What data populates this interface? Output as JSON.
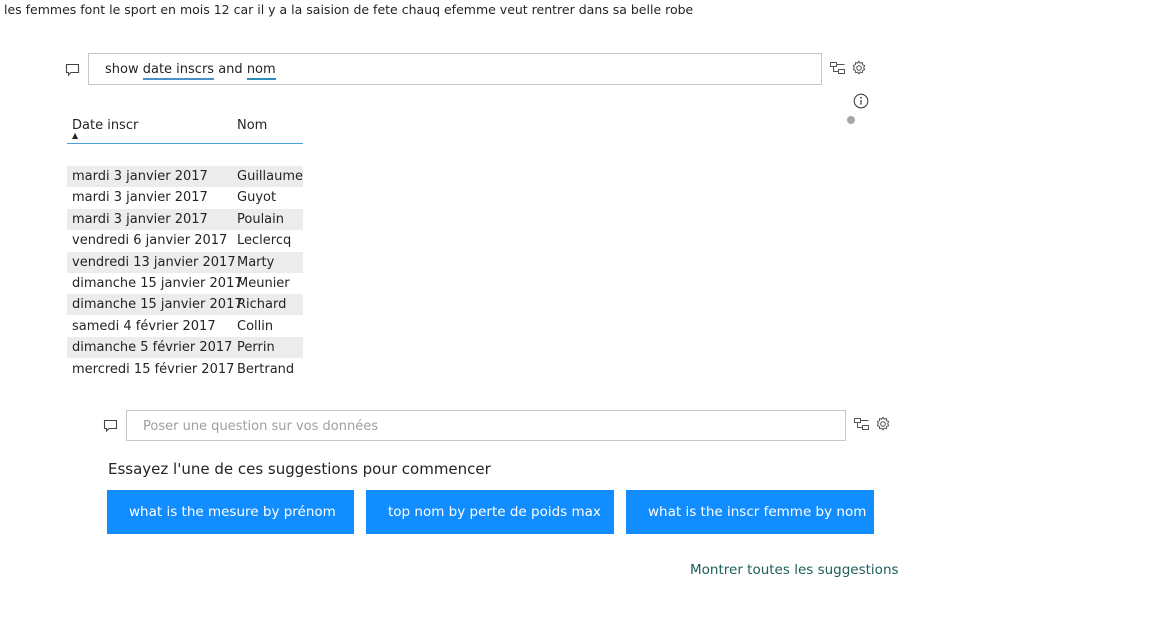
{
  "top_text": "les femmes font le sport en mois 12 car il y a la saision de fete chauq efemme veut rentrer dans sa belle robe",
  "qa_visual": {
    "query": {
      "prefix": "show ",
      "term1": "date inscrs",
      "mid": " and ",
      "term2": "nom"
    },
    "icons": [
      "comment-icon",
      "hierarchy-icon",
      "gear-icon",
      "info-icon"
    ]
  },
  "table": {
    "headers": [
      "Date inscr",
      "Nom"
    ],
    "sort_indicator": "▲",
    "rows": [
      [
        "mardi 3 janvier 2017",
        "Guillaume"
      ],
      [
        "mardi 3 janvier 2017",
        "Guyot"
      ],
      [
        "mardi 3 janvier 2017",
        "Poulain"
      ],
      [
        "vendredi 6 janvier 2017",
        "Leclercq"
      ],
      [
        "vendredi 13 janvier 2017",
        "Marty"
      ],
      [
        "dimanche 15 janvier 2017",
        "Meunier"
      ],
      [
        "dimanche 15 janvier 2017",
        "Richard"
      ],
      [
        "samedi 4 février 2017",
        "Collin"
      ],
      [
        "dimanche 5 février 2017",
        "Perrin"
      ],
      [
        "mercredi 15 février 2017",
        "Bertrand"
      ]
    ]
  },
  "qa_new": {
    "placeholder": "Poser une question sur vos données",
    "suggestions_title": "Essayez l'une de ces suggestions pour commencer",
    "suggestions": [
      "what is the mesure by prénom",
      "top nom by perte de poids max",
      "what is the inscr femme by nom"
    ],
    "show_all": "Montrer toutes les suggestions"
  },
  "colors": {
    "accent": "#118dff",
    "header_line": "#41a4d8",
    "row_alt": "#ececec",
    "link": "#1b5e5a"
  }
}
